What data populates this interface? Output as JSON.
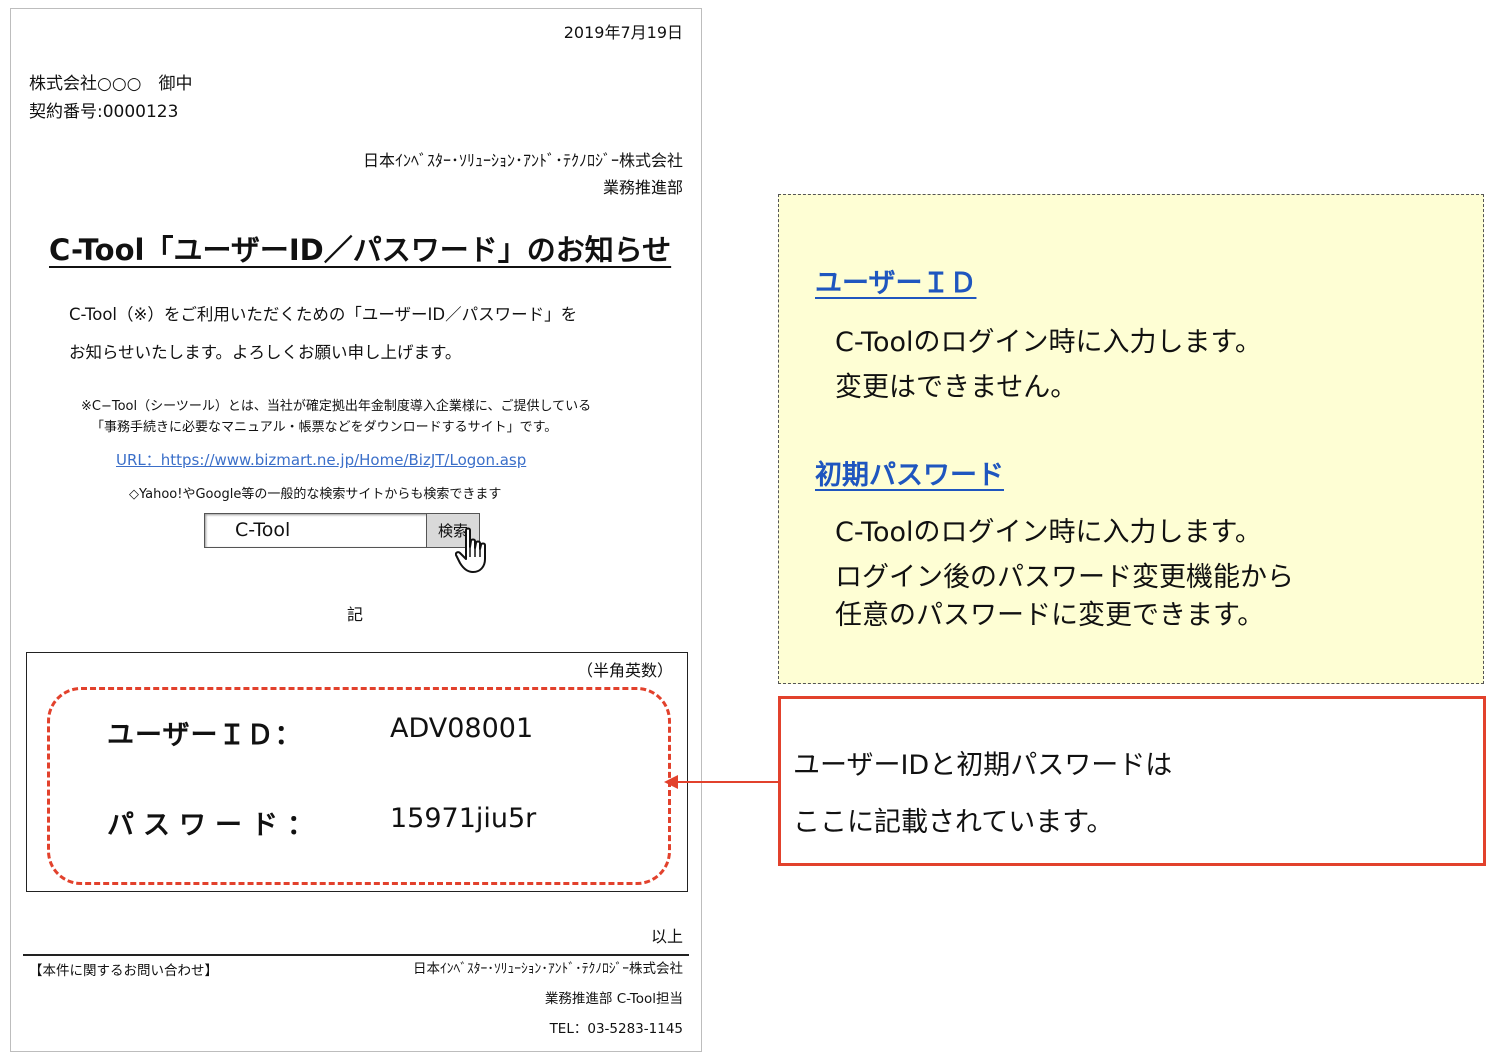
{
  "document": {
    "date": "2019年7月19日",
    "addressee": "株式会社○○○　御中",
    "contract_number": "契約番号:0000123",
    "company": "日本ｲﾝﾍﾞｽﾀｰ･ｿﾘｭｰｼｮﾝ･ｱﾝﾄﾞ･ﾃｸﾉﾛｼﾞｰ株式会社",
    "department": "業務推進部",
    "title": "C-Tool「ユーザーID／パスワード」のお知らせ",
    "body_line1": "C-Tool（※）をご利用いただくための「ユーザーID／パスワード」を",
    "body_line2": "お知らせいたします。よろしくお願い申し上げます。",
    "note_line1": "※C−Tool（シーツール）とは、当社が確定拠出年金制度導入企業様に、ご提供している",
    "note_line2": "「事務手続きに必要なマニュアル・帳票などをダウンロードするサイト」です。",
    "url": "URL：https://www.bizmart.ne.jp/Home/BizJT/Logon.asp",
    "search_hint": "◇Yahoo!やGoogle等の一般的な検索サイトからも検索できます",
    "search_value": "C-Tool",
    "search_button": "検索",
    "ki": "記",
    "hankaku": "（半角英数）",
    "user_id_label": "ユーザーＩＤ：",
    "user_id_value": "ADV08001",
    "password_label": "パスワード：",
    "password_value": "15971jiu5r",
    "ijo": "以上",
    "inquiry": "【本件に関するお問い合わせ】",
    "footer_company": "日本ｲﾝﾍﾞｽﾀｰ･ｿﾘｭｰｼｮﾝ･ｱﾝﾄﾞ･ﾃｸﾉﾛｼﾞｰ株式会社",
    "footer_dept": "業務推進部 C-Tool担当",
    "footer_tel": "TEL：03-5283-1145"
  },
  "explanation": {
    "user_id_heading": "ユーザーＩＤ",
    "user_id_line1": "C-Toolのログイン時に入力します。",
    "user_id_line2": "変更はできません。",
    "password_heading": "初期パスワード",
    "password_line1": "C-Toolのログイン時に入力します。",
    "password_line2": "ログイン後のパスワード変更機能から",
    "password_line3": "任意のパスワードに変更できます。"
  },
  "callout": {
    "line1": "ユーザーIDと初期パスワードは",
    "line2": "ここに記載されています。"
  },
  "colors": {
    "accent_red": "#e2412c",
    "heading_blue": "#1f56bf",
    "note_background": "#fefed4",
    "link_blue": "#3b6fc9"
  }
}
